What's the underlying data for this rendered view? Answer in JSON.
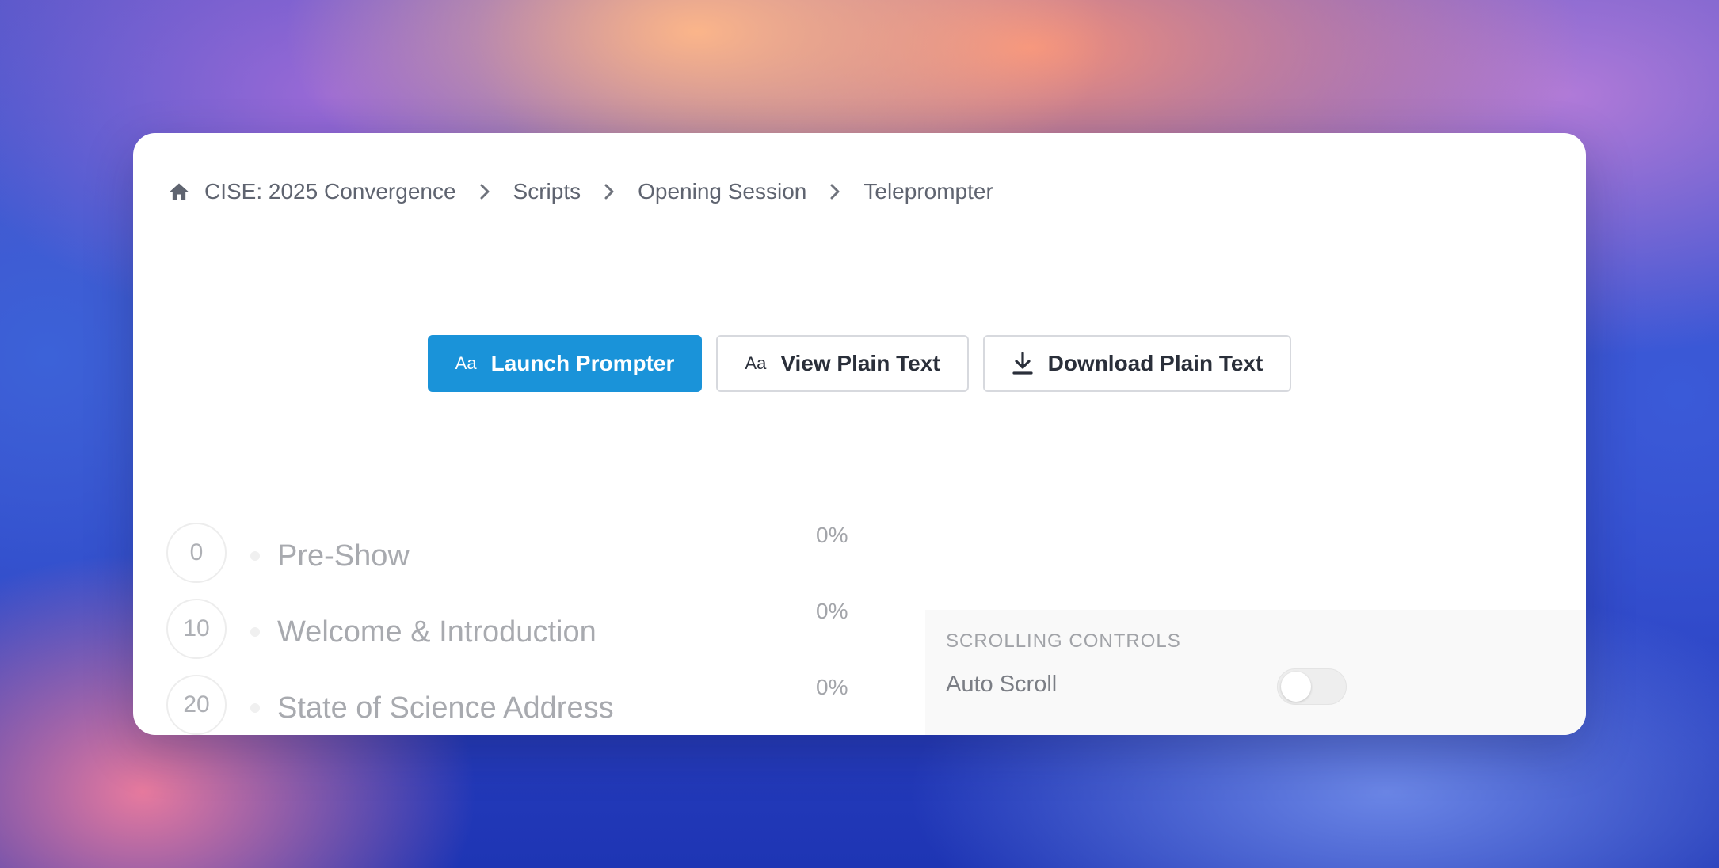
{
  "breadcrumb": {
    "items": [
      {
        "label": "CISE: 2025 Convergence",
        "icon": "home-icon"
      },
      {
        "label": "Scripts"
      },
      {
        "label": "Opening Session"
      },
      {
        "label": "Teleprompter"
      }
    ]
  },
  "actions": {
    "launch_label": "Launch Prompter",
    "launch_icon": "Aa",
    "view_label": "View Plain Text",
    "view_icon": "Aa",
    "download_label": "Download Plain Text",
    "download_icon": "download-icon"
  },
  "segments": [
    {
      "number": "0",
      "title": "Pre-Show",
      "progress": "0%"
    },
    {
      "number": "10",
      "title": "Welcome & Introduction",
      "progress": "0%"
    },
    {
      "number": "20",
      "title": "State of Science Address",
      "progress": "0%"
    }
  ],
  "controls": {
    "heading": "SCROLLING CONTROLS",
    "auto_scroll_label": "Auto Scroll",
    "auto_scroll_on": false
  },
  "colors": {
    "primary": "#1a93d9",
    "text": "#2a2f3a",
    "muted": "#a8aaaf"
  }
}
